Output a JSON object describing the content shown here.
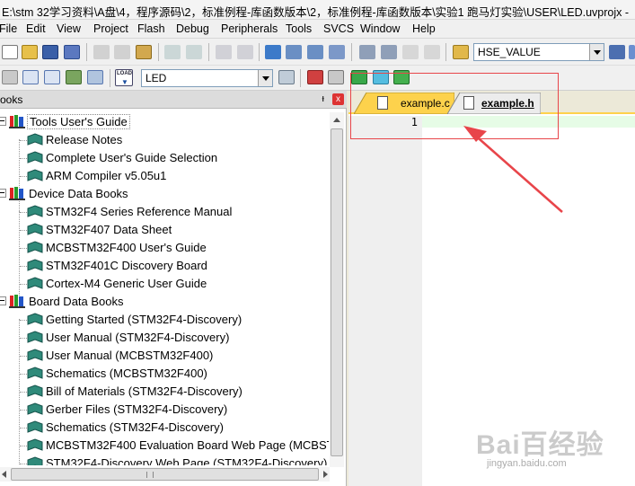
{
  "window": {
    "title": "E:\\stm 32学习资料\\A盘\\4，程序源码\\2，标准例程-库函数版本\\2，标准例程-库函数版本\\实验1 跑马灯实验\\USER\\LED.uvprojx -"
  },
  "menu": [
    "File",
    "Edit",
    "View",
    "Project",
    "Flash",
    "Debug",
    "Peripherals",
    "Tools",
    "SVCS",
    "Window",
    "Help"
  ],
  "toolbar": {
    "find_combo_value": "HSE_VALUE",
    "target_combo_value": "LED",
    "load_label": "LOAD"
  },
  "books_pane": {
    "title": "ooks",
    "pin": "ᵼ",
    "close": "x",
    "groups": [
      {
        "label": "Tools User's Guide",
        "items": [
          "Release Notes",
          "Complete User's Guide Selection",
          "ARM Compiler v5.05u1"
        ]
      },
      {
        "label": "Device Data Books",
        "items": [
          "STM32F4 Series Reference Manual",
          "STM32F407 Data Sheet",
          "MCBSTM32F400 User's Guide",
          "STM32F401C Discovery Board",
          "Cortex-M4 Generic User Guide"
        ]
      },
      {
        "label": "Board Data Books",
        "items": [
          "Getting Started (STM32F4-Discovery)",
          "User Manual (STM32F4-Discovery)",
          "User Manual (MCBSTM32F400)",
          "Schematics (MCBSTM32F400)",
          "Bill of Materials (STM32F4-Discovery)",
          "Gerber Files (STM32F4-Discovery)",
          "Schematics (STM32F4-Discovery)",
          "MCBSTM32F400 Evaluation Board Web Page (MCBSTI",
          "STM32F4-Discovery Web Page (STM32F4-Discovery)"
        ]
      }
    ]
  },
  "editor": {
    "tabs": [
      {
        "label": "example.c",
        "active": false
      },
      {
        "label": "example.h",
        "active": true
      }
    ],
    "line_numbers": [
      "1"
    ]
  },
  "watermark": {
    "text": "Bai百经验",
    "sub": "jingyan.baidu.com"
  },
  "colors": {
    "annotation_red": "#e8454a",
    "tab_yellow": "#fdd24c",
    "current_line": "#e6fce6"
  }
}
